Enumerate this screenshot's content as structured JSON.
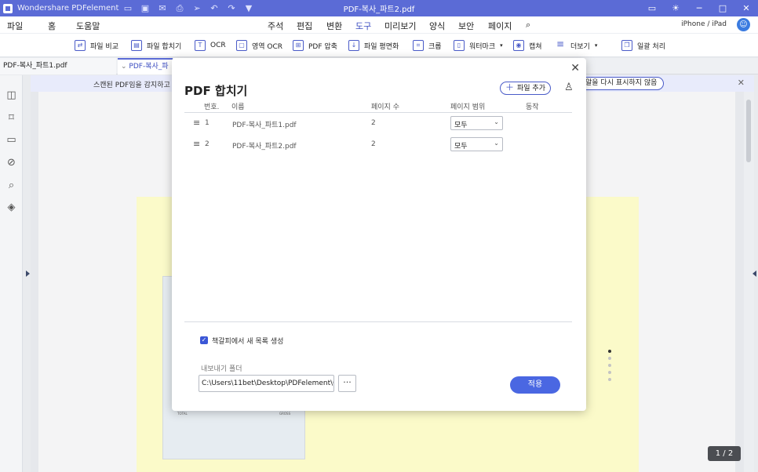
{
  "app": {
    "name": "Wondershare PDFelement",
    "doc_title": "PDF-복사_파트2.pdf"
  },
  "menu": {
    "items": [
      "파일",
      "홈",
      "도움말",
      "주석",
      "편집",
      "변환",
      "도구",
      "미리보기",
      "양식",
      "보안",
      "페이지"
    ],
    "active": "도구",
    "device": "iPhone / iPad"
  },
  "ribbon": {
    "tools": [
      "파일 비교",
      "파일 합치기",
      "OCR",
      "영역 OCR",
      "PDF 압축",
      "파일 평면화",
      "크롭",
      "워터마크",
      "캡쳐",
      "더보기",
      "일괄 처리"
    ]
  },
  "tabs": [
    "PDF-복사_파트1.pdf",
    "PDF-복사_파"
  ],
  "notice": {
    "message": "스캔된 PDF임을 감지하고",
    "button": "알을 다시 표시하지 않음"
  },
  "dialog": {
    "title": "PDF 합치기",
    "add_file": "파일 추가",
    "columns": [
      "번호.",
      "이름",
      "페이지 수",
      "페이지 범위",
      "동작"
    ],
    "rows": [
      {
        "num": "1",
        "name": "PDF-복사_파트1.pdf",
        "pages": "2",
        "range": "모두"
      },
      {
        "num": "2",
        "name": "PDF-복사_파트2.pdf",
        "pages": "2",
        "range": "모두"
      }
    ],
    "bookmark_label": "책갈피에서 새 목록 생성",
    "bookmark_checked": true,
    "folder_label": "내보내기 폴더",
    "folder_path": "C:\\Users\\11bet\\Desktop\\PDFelement\\C",
    "browse": "···",
    "apply": "적용"
  },
  "document": {
    "page_indicator": "1 / 2",
    "inner_total": "TOTAL",
    "inner_gross": "GROSS"
  },
  "colors": {
    "titlebar": "#5b6bd6",
    "accent": "#4a67e2",
    "doc_yellow": "#fbfac9"
  }
}
